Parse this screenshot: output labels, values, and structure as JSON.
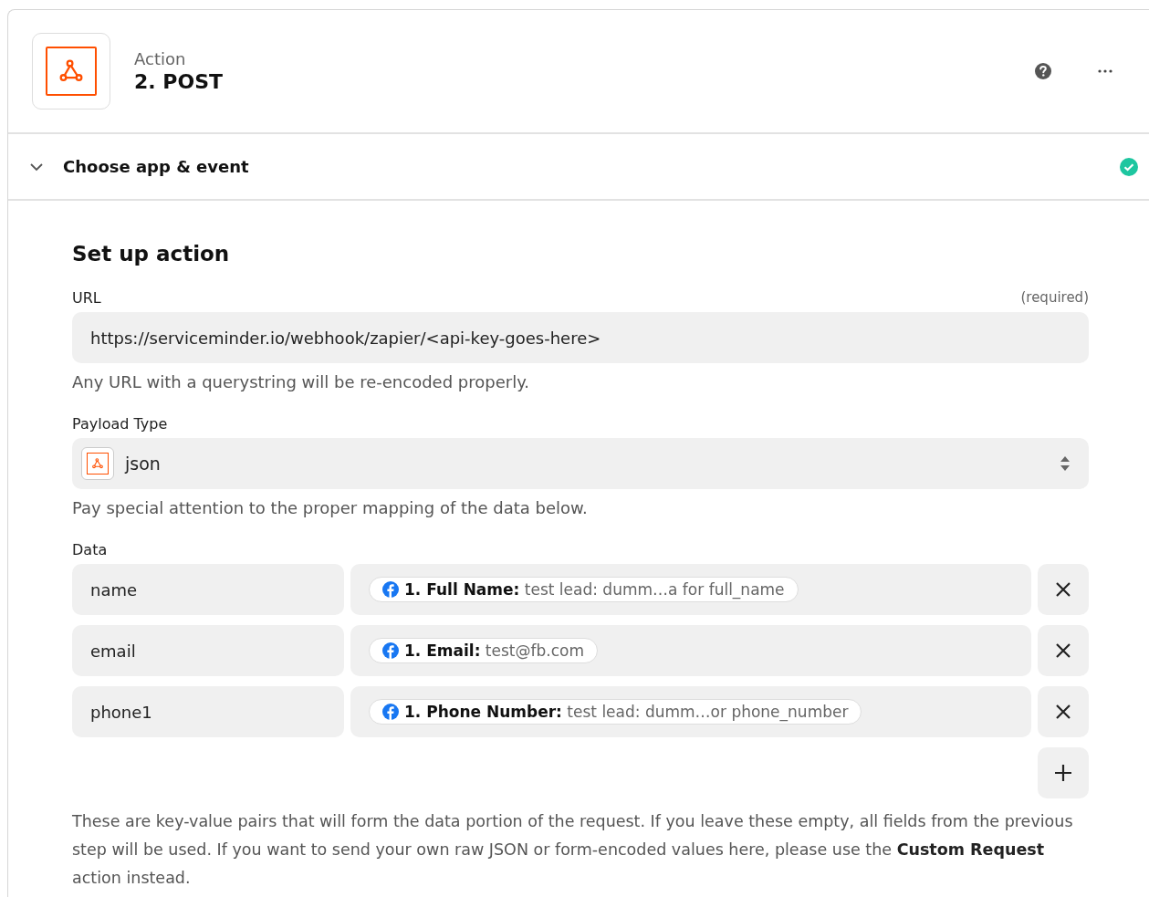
{
  "header": {
    "kind_label": "Action",
    "title": "2. POST"
  },
  "section": {
    "title": "Choose app & event",
    "expanded": true,
    "complete": true
  },
  "setup": {
    "title": "Set up action",
    "url": {
      "label": "URL",
      "required_note": "(required)",
      "value": "https://serviceminder.io/webhook/zapier/<api-key-goes-here>",
      "help": "Any URL with a querystring will be re-encoded properly."
    },
    "payload_type": {
      "label": "Payload Type",
      "value": "json",
      "help": "Pay special attention to the proper mapping of the data below."
    },
    "data": {
      "label": "Data",
      "rows": [
        {
          "key": "name",
          "value": "**1. Full Name:** test lead: dumm…a for full_name"
        },
        {
          "key": "email",
          "value": "**1. Email:** test@fb.com"
        },
        {
          "key": "phone1",
          "value": "**1. Phone Number:** test lead: dumm…or phone_number"
        }
      ],
      "help": "These are key-value pairs that will form the data portion of the request. If you leave these empty, all fields from the previous step will be used. If you want to send your own raw JSON or form-encoded values here, please use the **Custom Request** action instead."
    }
  }
}
